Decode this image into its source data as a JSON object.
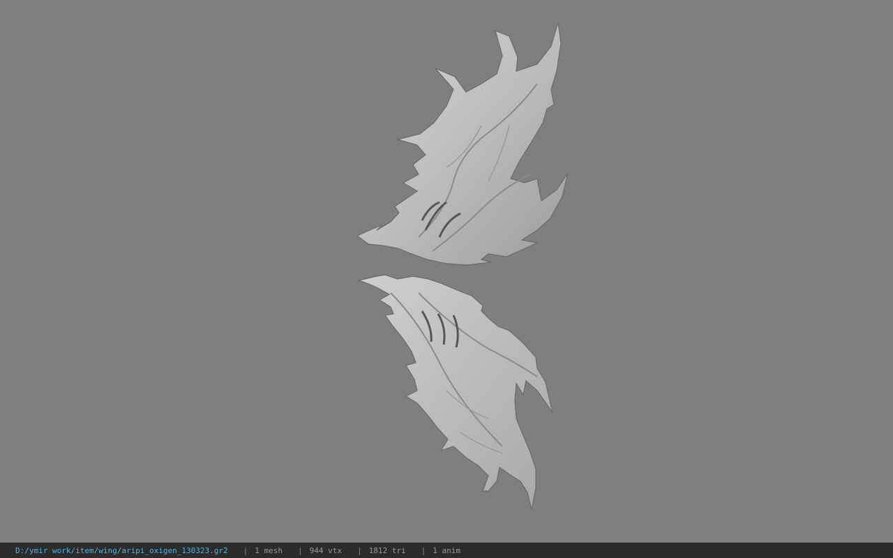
{
  "statusbar": {
    "file_path": "D:/ymir work/item/wing/aripi_oxigen_130323.gr2",
    "separator": "|",
    "stats": [
      {
        "label": "1 mesh"
      },
      {
        "label": "944 vtx"
      },
      {
        "label": "1812 tri"
      },
      {
        "label": "1 anim"
      }
    ]
  },
  "colors": {
    "background": "#7f7f7f",
    "statusbar_bg": "#2b2b2b",
    "path_text": "#4fb3e6",
    "stat_text": "#9a9a9a"
  }
}
